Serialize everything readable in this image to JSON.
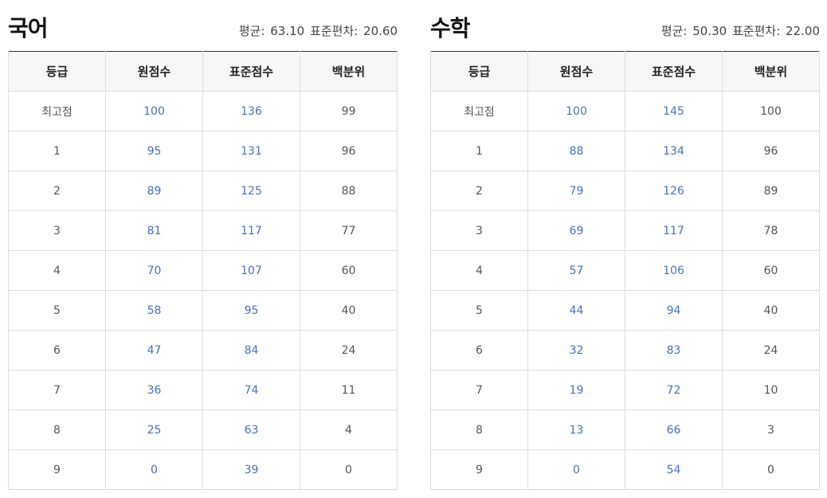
{
  "columns": [
    "등급",
    "원점수",
    "표준점수",
    "백분위"
  ],
  "subjects": [
    {
      "title": "국어",
      "mean_label": "평균:",
      "mean": "63.10",
      "std_label": "표준편차:",
      "std": "20.60",
      "rows": [
        {
          "grade": "최고점",
          "raw": "100",
          "standard": "136",
          "percentile": "99"
        },
        {
          "grade": "1",
          "raw": "95",
          "standard": "131",
          "percentile": "96"
        },
        {
          "grade": "2",
          "raw": "89",
          "standard": "125",
          "percentile": "88"
        },
        {
          "grade": "3",
          "raw": "81",
          "standard": "117",
          "percentile": "77"
        },
        {
          "grade": "4",
          "raw": "70",
          "standard": "107",
          "percentile": "60"
        },
        {
          "grade": "5",
          "raw": "58",
          "standard": "95",
          "percentile": "40"
        },
        {
          "grade": "6",
          "raw": "47",
          "standard": "84",
          "percentile": "24"
        },
        {
          "grade": "7",
          "raw": "36",
          "standard": "74",
          "percentile": "11"
        },
        {
          "grade": "8",
          "raw": "25",
          "standard": "63",
          "percentile": "4"
        },
        {
          "grade": "9",
          "raw": "0",
          "standard": "39",
          "percentile": "0"
        }
      ]
    },
    {
      "title": "수학",
      "mean_label": "평균:",
      "mean": "50.30",
      "std_label": "표준편차:",
      "std": "22.00",
      "rows": [
        {
          "grade": "최고점",
          "raw": "100",
          "standard": "145",
          "percentile": "100"
        },
        {
          "grade": "1",
          "raw": "88",
          "standard": "134",
          "percentile": "96"
        },
        {
          "grade": "2",
          "raw": "79",
          "standard": "126",
          "percentile": "89"
        },
        {
          "grade": "3",
          "raw": "69",
          "standard": "117",
          "percentile": "78"
        },
        {
          "grade": "4",
          "raw": "57",
          "standard": "106",
          "percentile": "60"
        },
        {
          "grade": "5",
          "raw": "44",
          "standard": "94",
          "percentile": "40"
        },
        {
          "grade": "6",
          "raw": "32",
          "standard": "83",
          "percentile": "24"
        },
        {
          "grade": "7",
          "raw": "19",
          "standard": "72",
          "percentile": "10"
        },
        {
          "grade": "8",
          "raw": "13",
          "standard": "66",
          "percentile": "3"
        },
        {
          "grade": "9",
          "raw": "0",
          "standard": "54",
          "percentile": "0"
        }
      ]
    }
  ],
  "colors": {
    "value_blue": "#4472c4",
    "header_bg": "#f7f7f7",
    "border": "#dddddd"
  }
}
